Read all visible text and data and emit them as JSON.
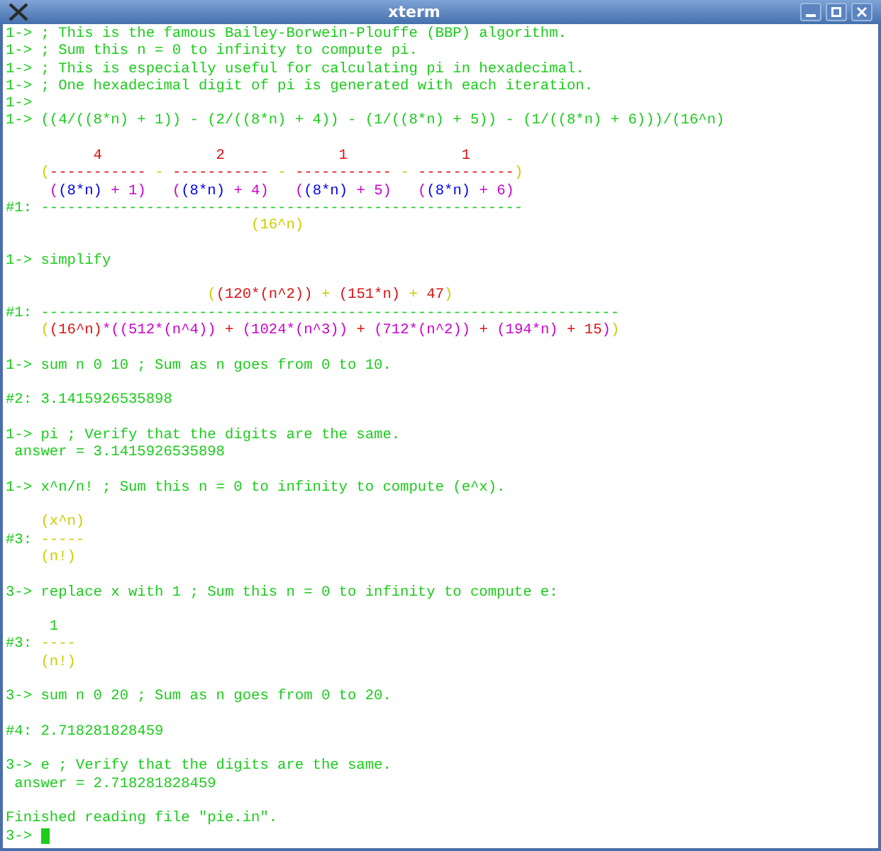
{
  "window": {
    "title": "xterm"
  },
  "terminal": {
    "cursor_visible": true,
    "lines": [
      {
        "kind": "text",
        "segments": [
          {
            "text": "1-> ; This is the famous Bailey-Borwein-Plouffe (BBP) algorithm.",
            "color": "#1ccc1c"
          }
        ]
      },
      {
        "kind": "text",
        "segments": [
          {
            "text": "1-> ; Sum this n = 0 to infinity to compute pi.",
            "color": "#1ccc1c"
          }
        ]
      },
      {
        "kind": "text",
        "segments": [
          {
            "text": "1-> ; This is especially useful for calculating pi in hexadecimal.",
            "color": "#1ccc1c"
          }
        ]
      },
      {
        "kind": "text",
        "segments": [
          {
            "text": "1-> ; One hexadecimal digit of pi is generated with each iteration.",
            "color": "#1ccc1c"
          }
        ]
      },
      {
        "kind": "text",
        "segments": [
          {
            "text": "1->",
            "color": "#1ccc1c"
          }
        ]
      },
      {
        "kind": "text",
        "segments": [
          {
            "text": "1-> ((4/((8*n) + 1)) - (2/((8*n) + 4)) - (1/((8*n) + 5)) - (1/((8*n) + 6)))/(16^n)",
            "color": "#1ccc1c"
          }
        ]
      },
      {
        "kind": "blank"
      },
      {
        "kind": "text",
        "segments": [
          {
            "text": "          4             2             1             1",
            "color": "#dd1111"
          }
        ]
      },
      {
        "kind": "text",
        "segments": [
          {
            "text": "    (",
            "color": "#cdcd00"
          },
          {
            "text": "-----------",
            "color": "#dd1111"
          },
          {
            "text": " - ",
            "color": "#cdcd00"
          },
          {
            "text": "-----------",
            "color": "#dd1111"
          },
          {
            "text": " - ",
            "color": "#cdcd00"
          },
          {
            "text": "-----------",
            "color": "#dd1111"
          },
          {
            "text": " - ",
            "color": "#cdcd00"
          },
          {
            "text": "-----------",
            "color": "#dd1111"
          },
          {
            "text": ")",
            "color": "#cdcd00"
          }
        ]
      },
      {
        "kind": "text",
        "segments": [
          {
            "text": "     (",
            "color": "#cd00cd"
          },
          {
            "text": "(8*n)",
            "color": "#0000ee"
          },
          {
            "text": " + 1)   (",
            "color": "#cd00cd"
          },
          {
            "text": "(8*n)",
            "color": "#0000ee"
          },
          {
            "text": " + 4)   (",
            "color": "#cd00cd"
          },
          {
            "text": "(8*n)",
            "color": "#0000ee"
          },
          {
            "text": " + 5)   (",
            "color": "#cd00cd"
          },
          {
            "text": "(8*n)",
            "color": "#0000ee"
          },
          {
            "text": " + 6)",
            "color": "#cd00cd"
          }
        ]
      },
      {
        "kind": "text",
        "segments": [
          {
            "text": "#1: -------------------------------------------------------",
            "color": "#1ccc1c"
          }
        ]
      },
      {
        "kind": "text",
        "segments": [
          {
            "text": "                            (16^n)",
            "color": "#cdcd00"
          }
        ]
      },
      {
        "kind": "blank"
      },
      {
        "kind": "text",
        "segments": [
          {
            "text": "1-> simplify",
            "color": "#1ccc1c"
          }
        ]
      },
      {
        "kind": "blank"
      },
      {
        "kind": "text",
        "segments": [
          {
            "text": "                       (",
            "color": "#cdcd00"
          },
          {
            "text": "(120*(n^2))",
            "color": "#dd1111"
          },
          {
            "text": " + ",
            "color": "#cdcd00"
          },
          {
            "text": "(151*n)",
            "color": "#dd1111"
          },
          {
            "text": " + ",
            "color": "#cdcd00"
          },
          {
            "text": "47",
            "color": "#dd1111"
          },
          {
            "text": ")",
            "color": "#cdcd00"
          }
        ]
      },
      {
        "kind": "text",
        "segments": [
          {
            "text": "#1: ------------------------------------------------------------------",
            "color": "#1ccc1c"
          }
        ]
      },
      {
        "kind": "text",
        "segments": [
          {
            "text": "    (",
            "color": "#cdcd00"
          },
          {
            "text": "(16^n)",
            "color": "#dd1111"
          },
          {
            "text": "*((512*(n^4))",
            "color": "#cd00cd"
          },
          {
            "text": " + ",
            "color": "#dd1111"
          },
          {
            "text": "(1024*(n^3))",
            "color": "#cd00cd"
          },
          {
            "text": " + ",
            "color": "#dd1111"
          },
          {
            "text": "(712*(n^2))",
            "color": "#cd00cd"
          },
          {
            "text": " + ",
            "color": "#dd1111"
          },
          {
            "text": "(194*n)",
            "color": "#cd00cd"
          },
          {
            "text": " + 15",
            "color": "#dd1111"
          },
          {
            "text": ")",
            "color": "#cd00cd"
          },
          {
            "text": ")",
            "color": "#cdcd00"
          }
        ]
      },
      {
        "kind": "blank"
      },
      {
        "kind": "text",
        "segments": [
          {
            "text": "1-> sum n 0 10 ; Sum as n goes from 0 to 10.",
            "color": "#1ccc1c"
          }
        ]
      },
      {
        "kind": "blank"
      },
      {
        "kind": "text",
        "segments": [
          {
            "text": "#2: 3.1415926535898",
            "color": "#1ccc1c"
          }
        ]
      },
      {
        "kind": "blank"
      },
      {
        "kind": "text",
        "segments": [
          {
            "text": "1-> pi ; Verify that the digits are the same.",
            "color": "#1ccc1c"
          }
        ]
      },
      {
        "kind": "text",
        "segments": [
          {
            "text": " answer = 3.1415926535898",
            "color": "#1ccc1c"
          }
        ]
      },
      {
        "kind": "blank"
      },
      {
        "kind": "text",
        "segments": [
          {
            "text": "1-> x^n/n! ; Sum this n = 0 to infinity to compute (e^x).",
            "color": "#1ccc1c"
          }
        ]
      },
      {
        "kind": "blank"
      },
      {
        "kind": "text",
        "segments": [
          {
            "text": "    (x^n)",
            "color": "#cdcd00"
          }
        ]
      },
      {
        "kind": "text",
        "segments": [
          {
            "text": "#3: ",
            "color": "#1ccc1c"
          },
          {
            "text": "-----",
            "color": "#cdcd00"
          }
        ]
      },
      {
        "kind": "text",
        "segments": [
          {
            "text": "    (n!)",
            "color": "#cdcd00"
          }
        ]
      },
      {
        "kind": "blank"
      },
      {
        "kind": "text",
        "segments": [
          {
            "text": "3-> replace x with 1 ; Sum this n = 0 to infinity to compute e:",
            "color": "#1ccc1c"
          }
        ]
      },
      {
        "kind": "blank"
      },
      {
        "kind": "text",
        "segments": [
          {
            "text": "     1",
            "color": "#1ccc1c"
          }
        ]
      },
      {
        "kind": "text",
        "segments": [
          {
            "text": "#3: ",
            "color": "#1ccc1c"
          },
          {
            "text": "----",
            "color": "#cdcd00"
          }
        ]
      },
      {
        "kind": "text",
        "segments": [
          {
            "text": "    (n!)",
            "color": "#cdcd00"
          }
        ]
      },
      {
        "kind": "blank"
      },
      {
        "kind": "text",
        "segments": [
          {
            "text": "3-> sum n 0 20 ; Sum as n goes from 0 to 20.",
            "color": "#1ccc1c"
          }
        ]
      },
      {
        "kind": "blank"
      },
      {
        "kind": "text",
        "segments": [
          {
            "text": "#4: 2.718281828459",
            "color": "#1ccc1c"
          }
        ]
      },
      {
        "kind": "blank"
      },
      {
        "kind": "text",
        "segments": [
          {
            "text": "3-> e ; Verify that the digits are the same.",
            "color": "#1ccc1c"
          }
        ]
      },
      {
        "kind": "text",
        "segments": [
          {
            "text": " answer = 2.718281828459",
            "color": "#1ccc1c"
          }
        ]
      },
      {
        "kind": "blank"
      },
      {
        "kind": "text",
        "segments": [
          {
            "text": "Finished reading file \"pie.in\".",
            "color": "#1ccc1c"
          }
        ]
      },
      {
        "kind": "text",
        "segments": [
          {
            "text": "3-> ",
            "color": "#1ccc1c"
          }
        ]
      }
    ]
  }
}
